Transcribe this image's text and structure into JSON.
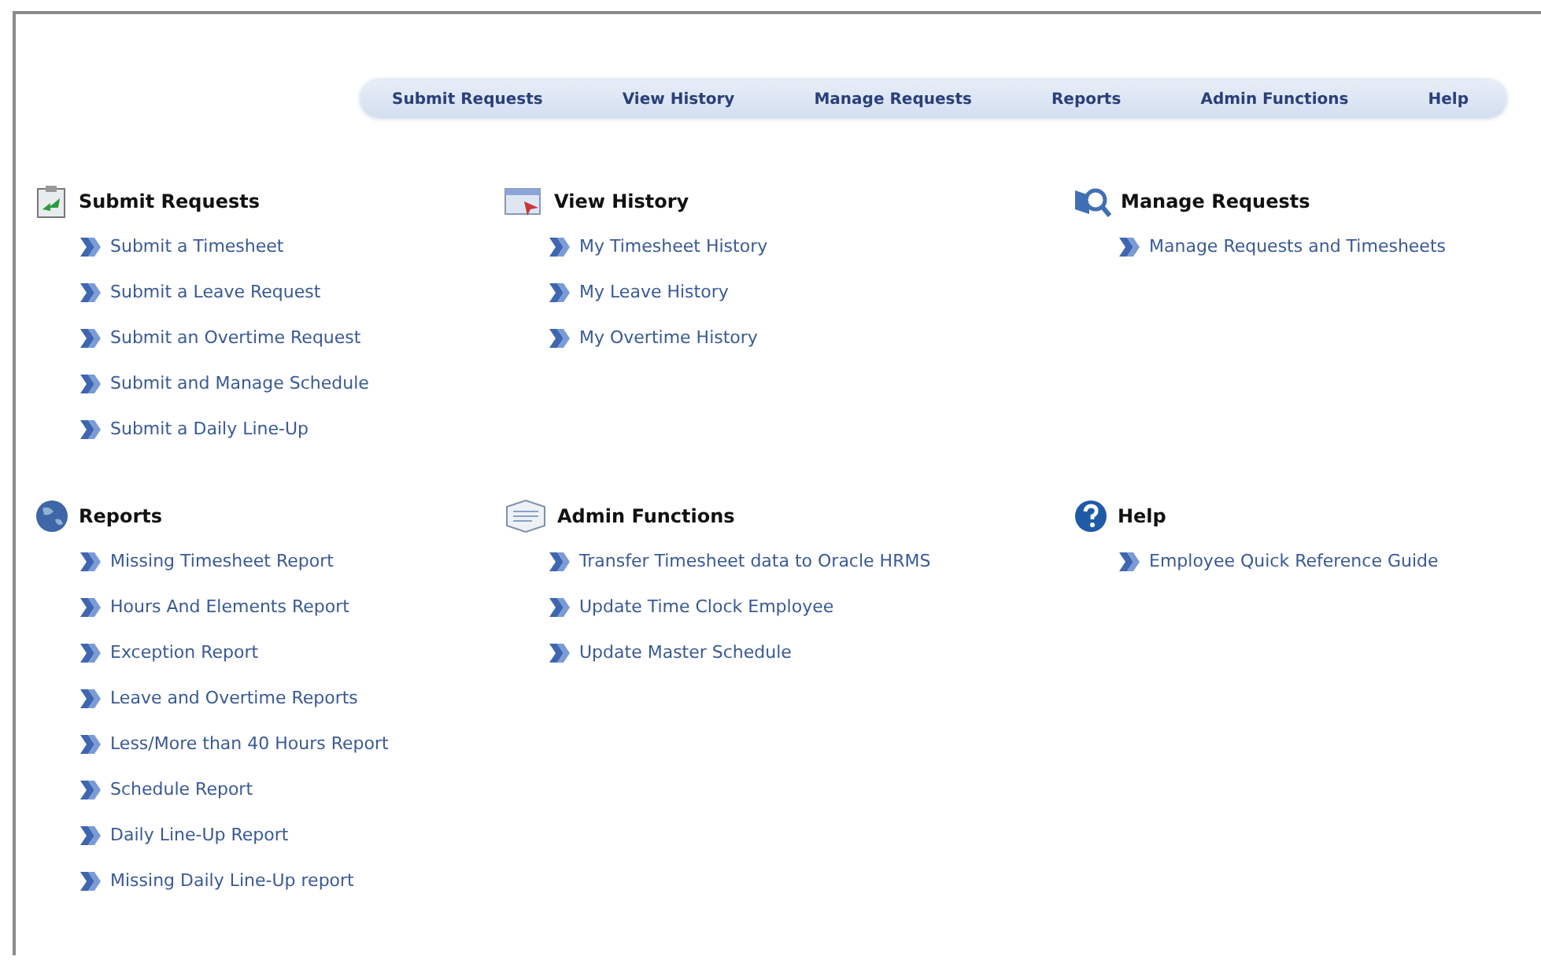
{
  "nav": [
    "Submit Requests",
    "View History",
    "Manage Requests",
    "Reports",
    "Admin Functions",
    "Help"
  ],
  "sections": [
    {
      "title": "Submit Requests",
      "kind": "clipboard",
      "links": [
        "Submit a Timesheet",
        "Submit a Leave Request",
        "Submit an Overtime Request",
        "Submit and Manage Schedule",
        "Submit a Daily Line-Up"
      ]
    },
    {
      "title": "View History",
      "kind": "window",
      "links": [
        "My Timesheet History",
        "My Leave History",
        "My Overtime History"
      ]
    },
    {
      "title": "Manage Requests",
      "kind": "magnifier",
      "links": [
        "Manage Requests and Timesheets"
      ]
    },
    {
      "title": "Reports",
      "kind": "globe",
      "links": [
        "Missing Timesheet Report",
        "Hours And Elements Report",
        "Exception Report",
        "Leave and Overtime Reports",
        "Less/More than 40 Hours Report",
        "Schedule Report",
        "Daily Line-Up Report",
        "Missing Daily Line-Up report"
      ]
    },
    {
      "title": "Admin Functions",
      "kind": "envelope",
      "links": [
        "Transfer Timesheet data to Oracle HRMS",
        "Update Time Clock Employee",
        "Update Master Schedule"
      ]
    },
    {
      "title": "Help",
      "kind": "help",
      "links": [
        "Employee Quick Reference Guide"
      ]
    }
  ]
}
